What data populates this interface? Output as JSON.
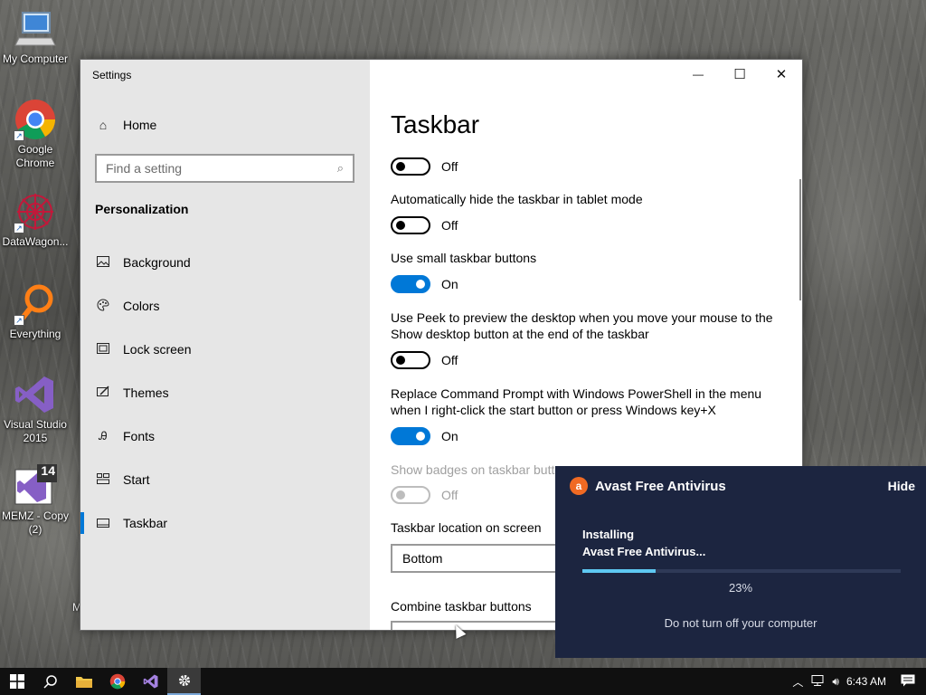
{
  "desktop": {
    "icons": [
      {
        "label": "My Computer",
        "icon": "monitor-icon"
      },
      {
        "label": "Google Chrome",
        "icon": "chrome-icon"
      },
      {
        "label": "DataWagon...",
        "icon": "datawagon-icon"
      },
      {
        "label": "Everything",
        "icon": "search-magnifier-icon"
      },
      {
        "label": "Visual Studio 2015",
        "icon": "visual-studio-icon"
      },
      {
        "label": "MEMZ - Copy (2)",
        "icon": "memz-icon",
        "badge": "14"
      }
    ],
    "partial_label": "M"
  },
  "settings": {
    "window_title": "Settings",
    "controls": {
      "minimize": "—",
      "maximize": "☐",
      "close": "✕"
    },
    "home_label": "Home",
    "search_placeholder": "Find a setting",
    "section": "Personalization",
    "nav": [
      {
        "label": "Background",
        "icon": "picture-icon"
      },
      {
        "label": "Colors",
        "icon": "palette-icon"
      },
      {
        "label": "Lock screen",
        "icon": "lock-screen-icon"
      },
      {
        "label": "Themes",
        "icon": "brush-icon"
      },
      {
        "label": "Fonts",
        "icon": "font-icon"
      },
      {
        "label": "Start",
        "icon": "start-layout-icon"
      },
      {
        "label": "Taskbar",
        "icon": "taskbar-icon",
        "active": true
      }
    ],
    "page_title": "Taskbar",
    "options": [
      {
        "label": "",
        "state": "Off",
        "on": false
      },
      {
        "label": "Automatically hide the taskbar in tablet mode",
        "state": "Off",
        "on": false
      },
      {
        "label": "Use small taskbar buttons",
        "state": "On",
        "on": true
      },
      {
        "label": "Use Peek to preview the desktop when you move your mouse to the Show desktop button at the end of the taskbar",
        "state": "Off",
        "on": false
      },
      {
        "label": "Replace Command Prompt with Windows PowerShell in the menu when I right-click the start button or press Windows key+X",
        "state": "On",
        "on": true
      },
      {
        "label": "Show badges on taskbar buttons",
        "state": "Off",
        "on": false,
        "disabled": true
      }
    ],
    "location_label": "Taskbar location on screen",
    "location_value": "Bottom",
    "combine_label": "Combine taskbar buttons"
  },
  "avast": {
    "title": "Avast Free Antivirus",
    "hide_label": "Hide",
    "status_line1": "Installing",
    "status_line2": "Avast Free Antivirus...",
    "progress": 0.23,
    "percent_label": "23%",
    "note": "Do not turn off your computer",
    "accent": "#f06a23",
    "bar_color": "#5ec8f2"
  },
  "taskbar": {
    "clock": "6:43 AM",
    "apps": [
      "windows-start-icon",
      "search-icon",
      "file-explorer-icon",
      "chrome-icon",
      "visual-studio-icon",
      "settings-gear-icon"
    ]
  }
}
